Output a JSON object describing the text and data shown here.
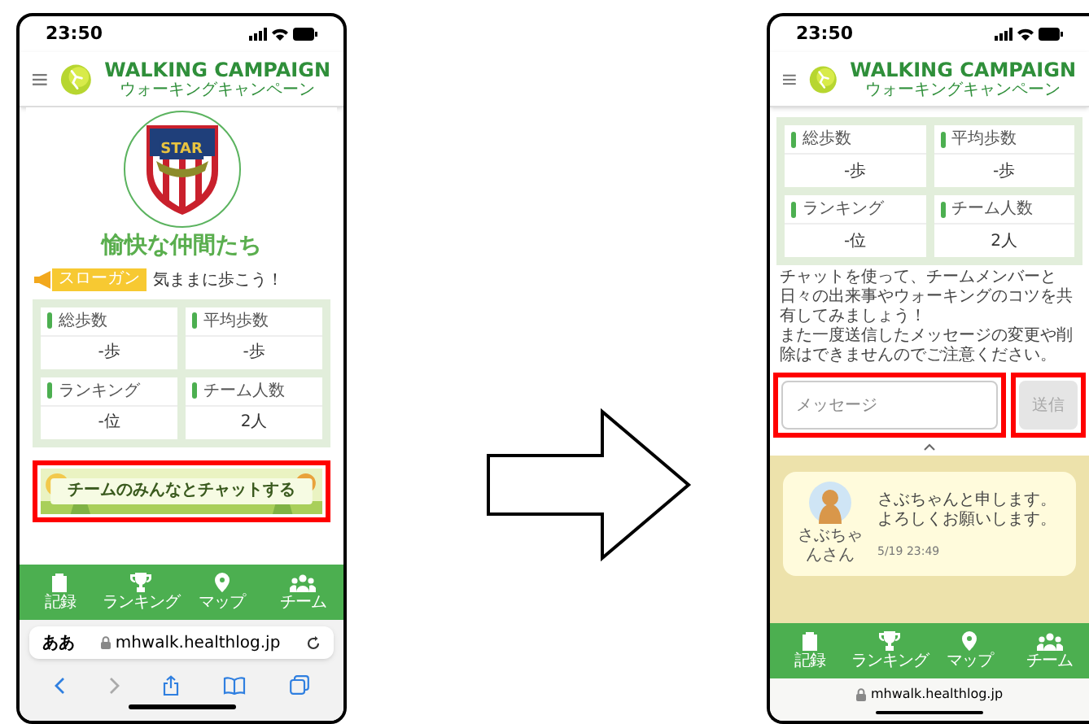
{
  "before_screen": {
    "status_time": "23:50",
    "logo_title": "WALKING CAMPAIGN",
    "logo_subtitle": "ウォーキングキャンペーン",
    "team_badge": "STAR",
    "team_name": "愉快な仲間たち",
    "slogan_label": "スローガン",
    "slogan": "気ままに歩こう！",
    "stats": [
      {
        "label": "総歩数",
        "value": "-歩"
      },
      {
        "label": "平均歩数",
        "value": "-歩"
      },
      {
        "label": "ランキング",
        "value": "-位"
      },
      {
        "label": "チーム人数",
        "value": "2人"
      }
    ],
    "chat_banner": {
      "label": "チームのみんなとチャットする",
      "highlighted": true
    },
    "nav": [
      {
        "label": "記録"
      },
      {
        "label": "ランキング"
      },
      {
        "label": "マップ"
      },
      {
        "label": "チーム"
      }
    ],
    "browser": {
      "text_size": "ああ",
      "url": "mhwalk.healthlog.jp"
    }
  },
  "after_screen": {
    "status_time": "23:50",
    "logo_title": "WALKING CAMPAIGN",
    "logo_subtitle": "ウォーキングキャンペーン",
    "stats": [
      {
        "label": "総歩数",
        "value": "-歩"
      },
      {
        "label": "平均歩数",
        "value": "-歩"
      },
      {
        "label": "ランキング",
        "value": "-位"
      },
      {
        "label": "チーム人数",
        "value": "2人"
      }
    ],
    "chat_intro": [
      "チャットを使って、チームメンバーと日々の出来事やウォーキングのコツを共有してみましょう！",
      "また一度送信したメッセージの変更や削除はできませんのでご注意ください。"
    ],
    "message_field": {
      "placeholder": "メッセージ",
      "highlighted": true
    },
    "send_button": {
      "label": "送信",
      "highlighted": true
    },
    "messages": [
      {
        "name": "さぶちゃんさん",
        "text": "さぶちゃんと申します。よろしくお願いします。",
        "time": "5/19 23:49"
      }
    ],
    "nav": [
      {
        "label": "記録"
      },
      {
        "label": "ランキング"
      },
      {
        "label": "マップ"
      },
      {
        "label": "チーム"
      }
    ],
    "url": "mhwalk.healthlog.jp"
  }
}
